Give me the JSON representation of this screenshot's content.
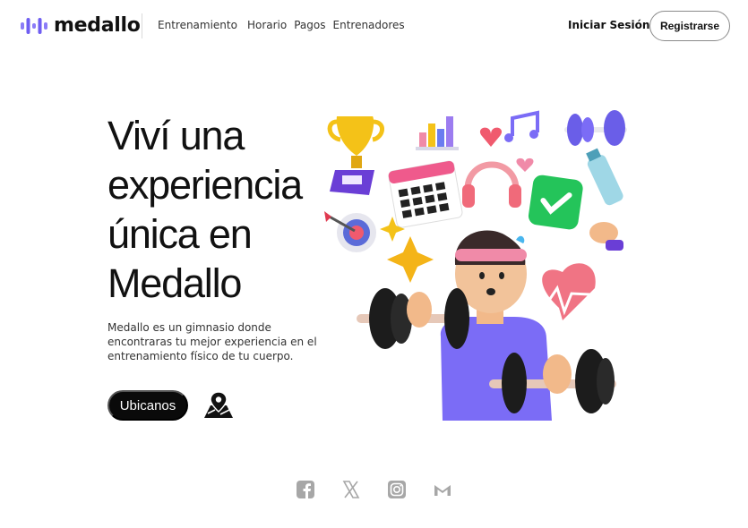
{
  "brand": {
    "name": "medallo",
    "logo_icon": "equalizer-bars-icon",
    "accent": "#7b6cf6"
  },
  "nav": {
    "items": [
      {
        "label": "Entrenamiento"
      },
      {
        "label": "Horario"
      },
      {
        "label": "Pagos"
      },
      {
        "label": "Entrenadores"
      }
    ],
    "login_label": "Iniciar Sesión",
    "register_label": "Registrarse"
  },
  "hero": {
    "title": "Viví una experiencia única en Medallo",
    "description": "Medallo es un gimnasio donde encontraras tu mejor experiencia en el entrenamiento físico de tu cuerpo.",
    "cta_label": "Ubicanos",
    "map_icon": "map-pin-icon",
    "illustration": "fitness-character-illustration"
  },
  "social": [
    {
      "name": "facebook",
      "icon": "facebook-icon"
    },
    {
      "name": "x",
      "icon": "x-icon"
    },
    {
      "name": "instagram",
      "icon": "instagram-icon"
    },
    {
      "name": "gmail",
      "icon": "gmail-icon"
    }
  ],
  "colors": {
    "dark": "#0a0a0a",
    "social_gray": "#a7a7a7",
    "purple": "#7b6cf6"
  }
}
